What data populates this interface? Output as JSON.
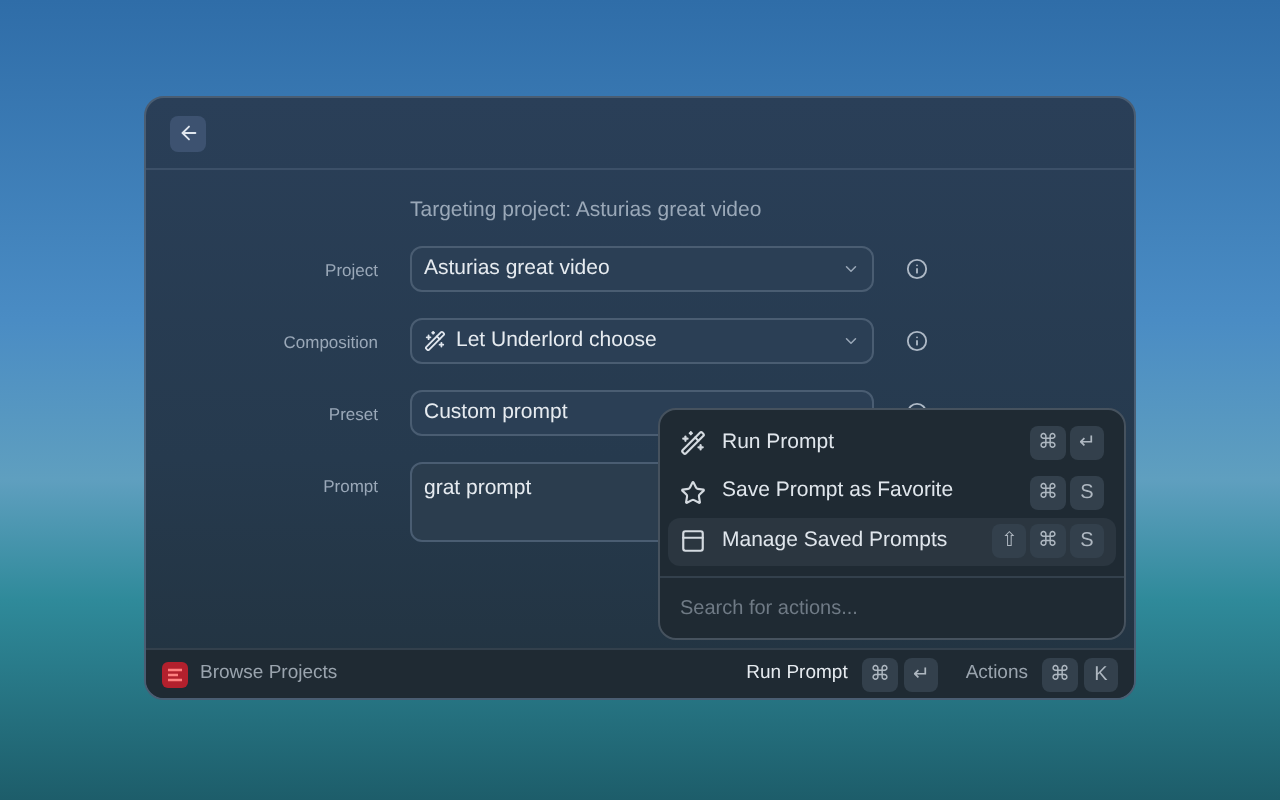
{
  "header": {
    "targeting": "Targeting project: Asturias great video"
  },
  "fields": [
    {
      "label": "Project",
      "kind": "select",
      "value": "Asturias great video",
      "leading_icon": false,
      "info": true
    },
    {
      "label": "Composition",
      "kind": "select",
      "value": "Let Underlord choose",
      "leading_icon": true,
      "info": true
    },
    {
      "label": "Preset",
      "kind": "select",
      "value": "Custom prompt",
      "leading_icon": false,
      "info": true
    },
    {
      "label": "Prompt",
      "kind": "textarea",
      "value": "grat prompt",
      "leading_icon": false
    }
  ],
  "menu": {
    "items": [
      {
        "kind": "wand",
        "label": "Run Prompt",
        "keys": [
          "⌘",
          "↵"
        ],
        "selected": false
      },
      {
        "kind": "star",
        "label": "Save Prompt as Favorite",
        "keys": [
          "⌘",
          "S"
        ],
        "selected": false
      },
      {
        "kind": "list",
        "label": "Manage Saved Prompts",
        "keys": [
          "⇧",
          "⌘",
          "S"
        ],
        "selected": true
      }
    ],
    "search_placeholder": "Search for actions..."
  },
  "footer": {
    "browse": "Browse Projects",
    "actions": [
      {
        "label": "Run Prompt",
        "keys": [
          "⌘",
          "↵"
        ]
      },
      {
        "label": "Actions",
        "keys": [
          "⌘",
          "K"
        ]
      }
    ]
  }
}
